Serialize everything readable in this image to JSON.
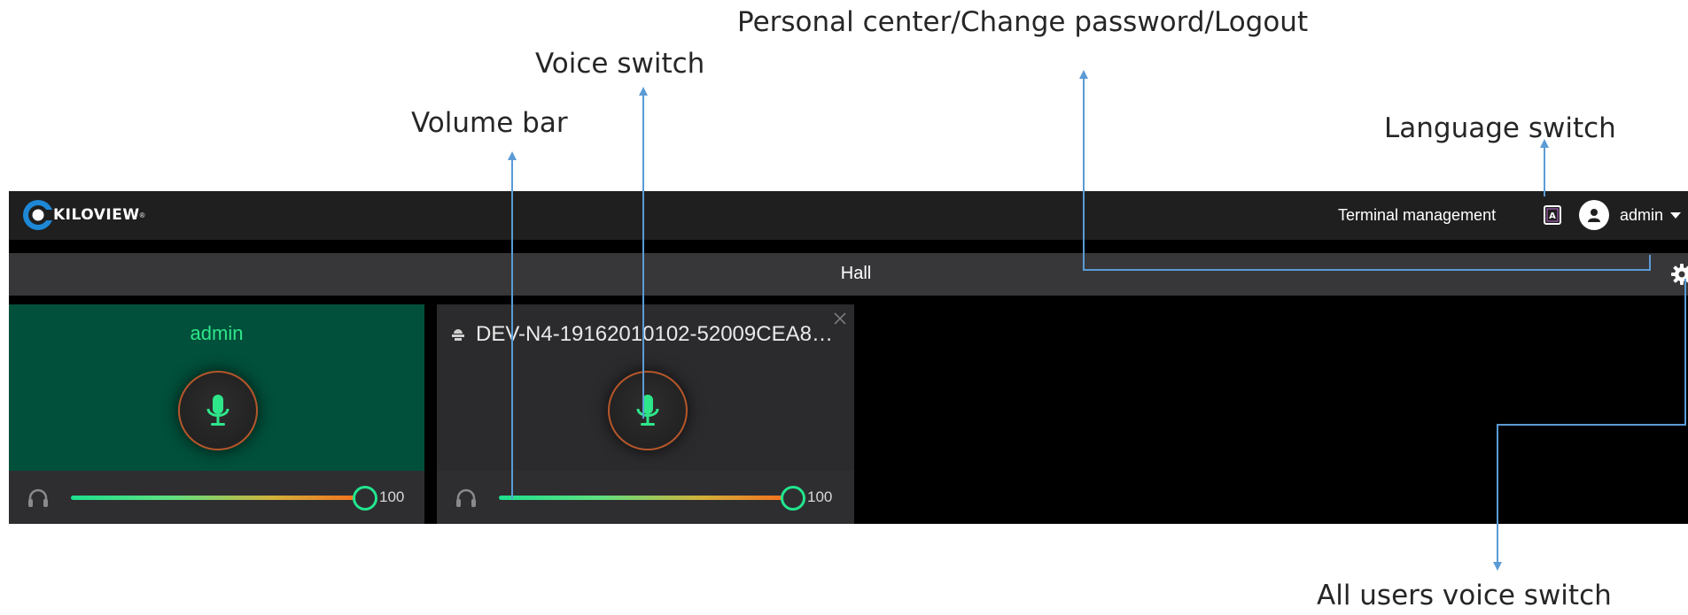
{
  "callouts": {
    "personal": "Personal center/Change password/Logout",
    "voice_switch": "Voice switch",
    "volume_bar": "Volume bar",
    "language_switch": "Language switch",
    "all_users_voice": "All users voice switch"
  },
  "topbar": {
    "brand": "KILOVIEW",
    "brand_reg": "®",
    "nav_link": "Terminal management",
    "user": "admin"
  },
  "hall": {
    "title": "Hall"
  },
  "cards": [
    {
      "name": "admin",
      "volume": 100,
      "volume_fraction": 1.0,
      "mic": "on"
    },
    {
      "name": "DEV-N4-19162010102-52009CEA8…",
      "volume": 100,
      "volume_fraction": 1.0,
      "mic": "on"
    }
  ],
  "colors": {
    "accent_green": "#2ee68a",
    "local_card_bg": "#00503b",
    "remote_card_bg": "#2b2b2e",
    "mic_ring": "#b5562a",
    "annotation_blue": "#5b9bd5"
  },
  "icons": [
    "logo-mark-icon",
    "language-icon",
    "avatar-icon",
    "chevron-down-icon",
    "settings-gear-icon",
    "device-icon",
    "close-icon",
    "microphone-icon",
    "headset-icon"
  ]
}
